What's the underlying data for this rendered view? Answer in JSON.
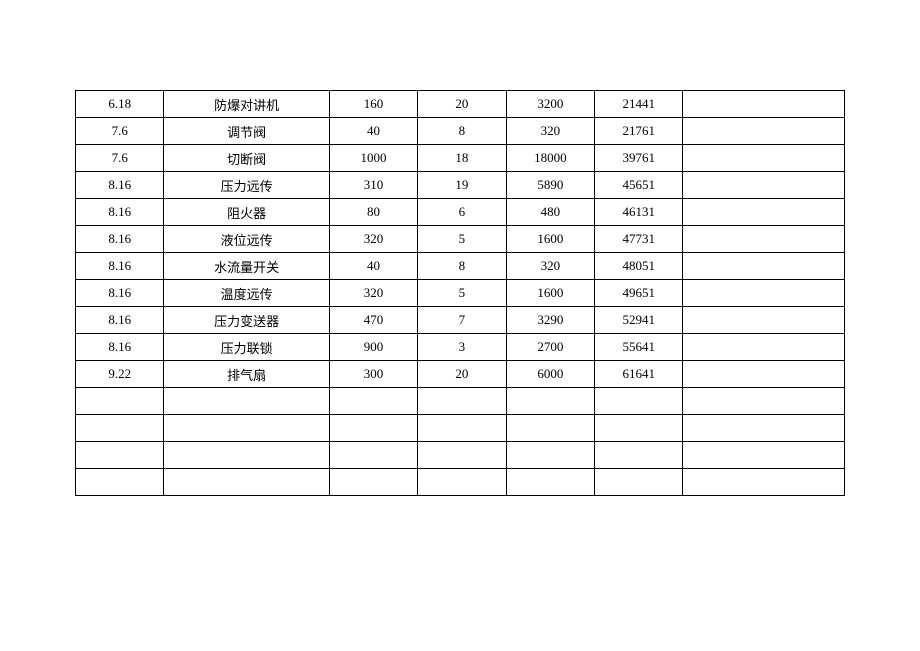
{
  "table": {
    "rows": [
      {
        "c1": "6.18",
        "c2": "防爆对讲机",
        "c3": "160",
        "c4": "20",
        "c5": "3200",
        "c6": "21441",
        "c7": ""
      },
      {
        "c1": "7.6",
        "c2": "调节阀",
        "c3": "40",
        "c4": "8",
        "c5": "320",
        "c6": "21761",
        "c7": ""
      },
      {
        "c1": "7.6",
        "c2": "切断阀",
        "c3": "1000",
        "c4": "18",
        "c5": "18000",
        "c6": "39761",
        "c7": ""
      },
      {
        "c1": "8.16",
        "c2": "压力远传",
        "c3": "310",
        "c4": "19",
        "c5": "5890",
        "c6": "45651",
        "c7": ""
      },
      {
        "c1": "8.16",
        "c2": "阻火器",
        "c3": "80",
        "c4": "6",
        "c5": "480",
        "c6": "46131",
        "c7": ""
      },
      {
        "c1": "8.16",
        "c2": "液位远传",
        "c3": "320",
        "c4": "5",
        "c5": "1600",
        "c6": "47731",
        "c7": ""
      },
      {
        "c1": "8.16",
        "c2": "水流量开关",
        "c3": "40",
        "c4": "8",
        "c5": "320",
        "c6": "48051",
        "c7": ""
      },
      {
        "c1": "8.16",
        "c2": "温度远传",
        "c3": "320",
        "c4": "5",
        "c5": "1600",
        "c6": "49651",
        "c7": ""
      },
      {
        "c1": "8.16",
        "c2": "压力变送器",
        "c3": "470",
        "c4": "7",
        "c5": "3290",
        "c6": "52941",
        "c7": ""
      },
      {
        "c1": "8.16",
        "c2": "压力联锁",
        "c3": "900",
        "c4": "3",
        "c5": "2700",
        "c6": "55641",
        "c7": ""
      },
      {
        "c1": "9.22",
        "c2": "排气扇",
        "c3": "300",
        "c4": "20",
        "c5": "6000",
        "c6": "61641",
        "c7": ""
      },
      {
        "c1": "",
        "c2": "",
        "c3": "",
        "c4": "",
        "c5": "",
        "c6": "",
        "c7": ""
      },
      {
        "c1": "",
        "c2": "",
        "c3": "",
        "c4": "",
        "c5": "",
        "c6": "",
        "c7": ""
      },
      {
        "c1": "",
        "c2": "",
        "c3": "",
        "c4": "",
        "c5": "",
        "c6": "",
        "c7": ""
      },
      {
        "c1": "",
        "c2": "",
        "c3": "",
        "c4": "",
        "c5": "",
        "c6": "",
        "c7": ""
      }
    ]
  }
}
